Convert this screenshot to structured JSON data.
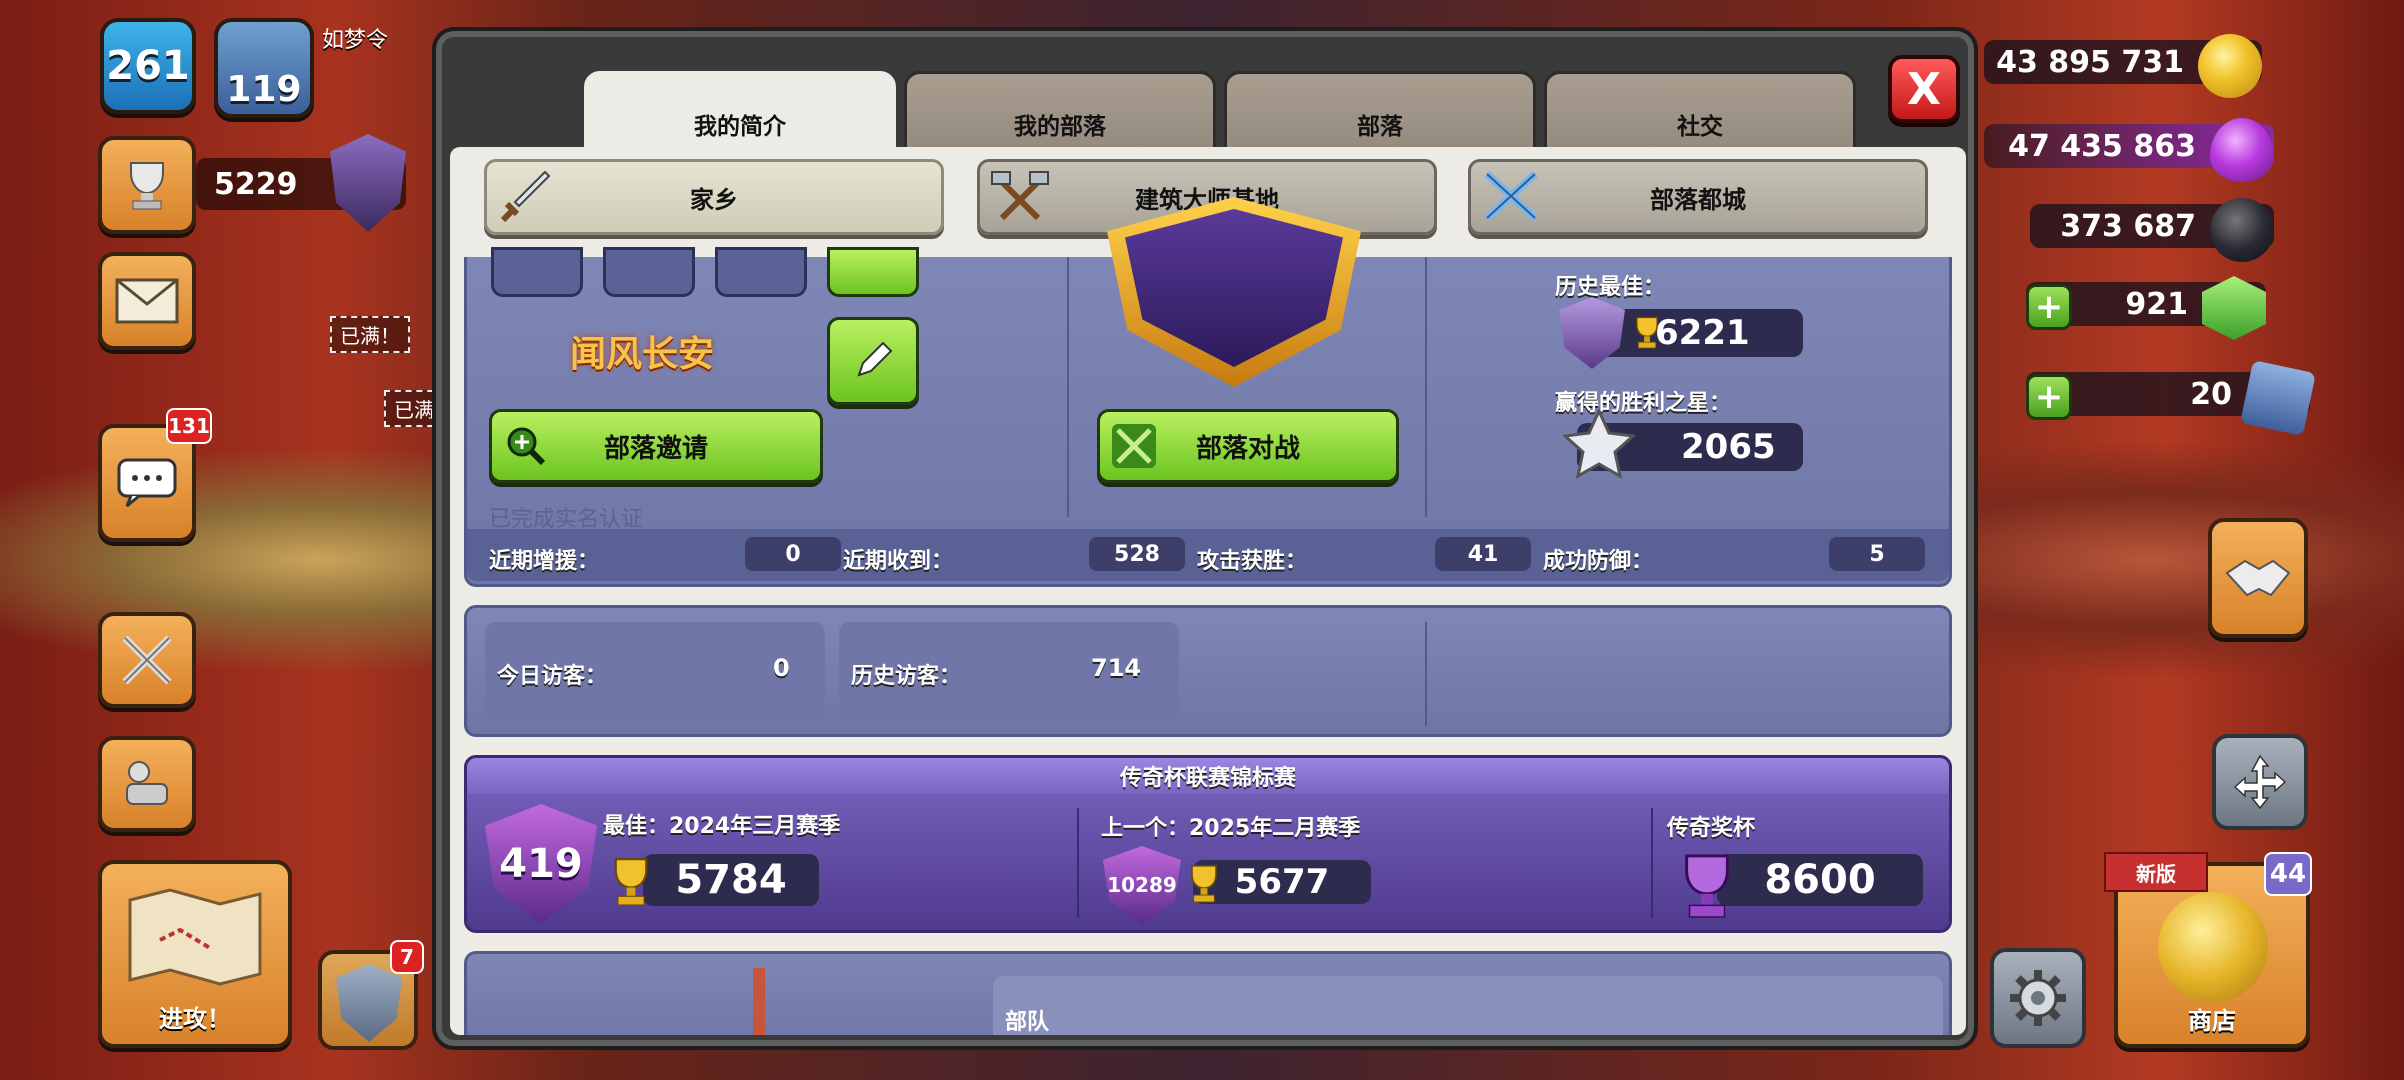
{
  "player": {
    "level": "261",
    "town_hall": "119",
    "name": "如梦令",
    "trophies": "5229",
    "chat_badge": "131",
    "shield_badge": "7"
  },
  "resources": {
    "gold": "43 895 731",
    "elixir": "47 435 863",
    "dark_elixir": "373 687",
    "gems": "921",
    "tickets": "20"
  },
  "left_hud": {
    "attack_label": "进攻！"
  },
  "right_hud": {
    "shop_label": "商店",
    "shop_new_badge": "新版",
    "shop_count": "44"
  },
  "map_labels": {
    "full1": "已满！",
    "full2": "已满"
  },
  "tabs": [
    {
      "label": "我的简介",
      "active": true
    },
    {
      "label": "我的部落"
    },
    {
      "label": "部落"
    },
    {
      "label": "社交"
    }
  ],
  "close_label": "X",
  "subtabs": [
    {
      "label": "家乡",
      "active": true
    },
    {
      "label": "建筑大师基地"
    },
    {
      "label": "部落都城"
    }
  ],
  "profile": {
    "title_art": "闻风长安",
    "invite_button": "部落邀请",
    "clan_war_button": "部落对战",
    "verified_text": "已完成实名认证",
    "best_label": "历史最佳：",
    "best_value": "6221",
    "stars_label": "赢得的胜利之星：",
    "stars_value": "2065"
  },
  "stats": [
    {
      "label": "近期增援：",
      "value": "0"
    },
    {
      "label": "近期收到：",
      "value": "528"
    },
    {
      "label": "攻击获胜：",
      "value": "41"
    },
    {
      "label": "成功防御：",
      "value": "5"
    }
  ],
  "visitors": {
    "today_label": "今日访客：",
    "today_value": "0",
    "total_label": "历史访客：",
    "total_value": "714"
  },
  "legend": {
    "title": "传奇杯联赛锦标赛",
    "rank_badge": "419",
    "best_label": "最佳：2024年三月赛季",
    "best_value": "5784",
    "prev_label": "上一个：2025年二月赛季",
    "prev_rank": "10289",
    "prev_value": "5677",
    "trophy_label": "传奇奖杯",
    "trophy_value": "8600"
  },
  "troops_label": "部队",
  "colors": {
    "gold": "#f2c22c",
    "elixir": "#b83adf",
    "dark": "#2b2b36",
    "gem": "#59c24a",
    "green_button": "#8ad83a",
    "legend_purple": "#6a4fb0"
  }
}
